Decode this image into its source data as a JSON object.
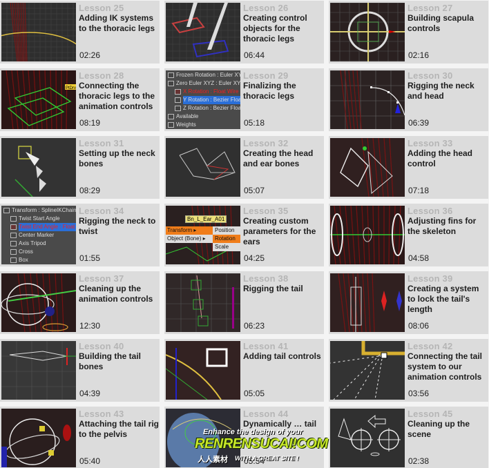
{
  "lessons": [
    {
      "lesson": "Lesson 25",
      "title": "Adding IK systems to the thoracic legs",
      "duration": "02:26",
      "thumb": "legs-ik"
    },
    {
      "lesson": "Lesson 26",
      "title": "Creating control objects for the thoracic legs",
      "duration": "06:44",
      "thumb": "leg-controls"
    },
    {
      "lesson": "Lesson 27",
      "title": "Building scapula controls",
      "duration": "02:16",
      "thumb": "circle-control"
    },
    {
      "lesson": "Lesson 28",
      "title": "Connecting the thoracic legs to the animation controls",
      "duration": "08:19",
      "thumb": "wire-boxes",
      "label": "PtDrv"
    },
    {
      "lesson": "Lesson 29",
      "title": "Finalizing the thoracic legs",
      "duration": "05:18",
      "thumb": "controller-list",
      "list": [
        "Frozen Rotation : Euler XYZ",
        "Zero Euler XYZ : Euler XYZ",
        "X Rotation : Float Wire",
        "Y Rotation : Bezier Float",
        "Z Rotation : Bezier Float",
        "Available",
        "Weights"
      ]
    },
    {
      "lesson": "Lesson 30",
      "title": "Rigging the neck and head",
      "duration": "06:39",
      "thumb": "spline-curve"
    },
    {
      "lesson": "Lesson 31",
      "title": "Setting up the neck bones",
      "duration": "08:29",
      "thumb": "neck-bones"
    },
    {
      "lesson": "Lesson 32",
      "title": "Creating the head and ear bones",
      "duration": "05:07",
      "thumb": "head-bones"
    },
    {
      "lesson": "Lesson 33",
      "title": "Adding the head control",
      "duration": "07:18",
      "thumb": "head-control"
    },
    {
      "lesson": "Lesson 34",
      "title": "Rigging the neck to twist",
      "duration": "01:55",
      "thumb": "controller-list",
      "list": [
        "Transform : SplineIKChain",
        "Twist Start Angle",
        "Twist End Angle : Float",
        "Center Marker",
        "Axis Tripod",
        "Cross",
        "Box"
      ]
    },
    {
      "lesson": "Lesson 35",
      "title": "Creating custom parameters for the ears",
      "duration": "04:25",
      "thumb": "quad-menu",
      "tag": "Bn_L_Ear_A01",
      "menu": [
        "Transform",
        "Object (Bone)"
      ],
      "submenu": [
        "Position",
        "Rotation",
        "Scale"
      ]
    },
    {
      "lesson": "Lesson 36",
      "title": "Adjusting fins for the skeleton",
      "duration": "04:58",
      "thumb": "fins"
    },
    {
      "lesson": "Lesson 37",
      "title": "Cleaning up the animation controls",
      "duration": "12:30",
      "thumb": "sphere-controls"
    },
    {
      "lesson": "Lesson 38",
      "title": "Rigging the tail",
      "duration": "06:23",
      "thumb": "tail-boxes"
    },
    {
      "lesson": "Lesson 39",
      "title": "Creating a system to lock the tail's length",
      "duration": "08:06",
      "thumb": "tail-lock"
    },
    {
      "lesson": "Lesson 40",
      "title": "Building the tail bones",
      "duration": "04:39",
      "thumb": "tail-bone"
    },
    {
      "lesson": "Lesson 41",
      "title": "Adding tail controls",
      "duration": "05:05",
      "thumb": "tail-controls"
    },
    {
      "lesson": "Lesson 42",
      "title": "Connecting the tail system to our animation controls",
      "duration": "03:56",
      "thumb": "dashed-lines"
    },
    {
      "lesson": "Lesson 43",
      "title": "Attaching the tail rig to the pelvis",
      "duration": "05:40",
      "thumb": "pelvis-sphere"
    },
    {
      "lesson": "Lesson 44",
      "title": "Dynamically … tail",
      "duration": "05:34",
      "thumb": "body-mesh"
    },
    {
      "lesson": "Lesson 45",
      "title": "Cleaning up the scene",
      "duration": "02:38",
      "thumb": "scene-controls"
    }
  ],
  "watermark": {
    "line1": "Enhance the design of your",
    "line2": "RENRENSUCAI!COM",
    "line3": "人人素材",
    "line4": "WITH A GREAT SITE !"
  }
}
